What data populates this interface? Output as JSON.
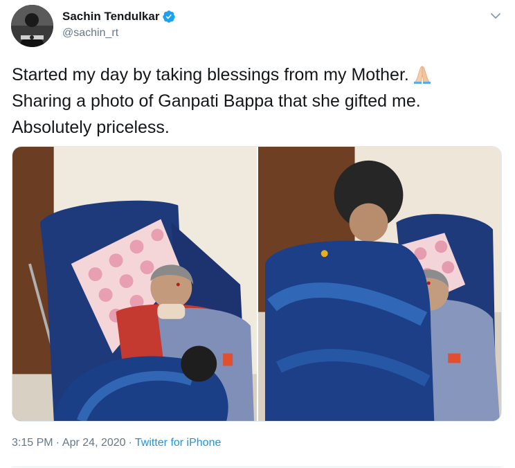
{
  "author": {
    "display_name": "Sachin Tendulkar",
    "handle": "@sachin_rt",
    "verified": true
  },
  "tweet": {
    "lines": [
      "Started my day by taking blessings from my Mother.",
      "Sharing a photo of Ganpati Bappa that she gifted me.",
      "Absolutely priceless."
    ],
    "emoji": "folded-hands"
  },
  "media": {
    "count": 2
  },
  "meta": {
    "time": "3:15 PM",
    "separator": "·",
    "date": "Apr 24, 2020",
    "source": "Twitter for iPhone"
  },
  "colors": {
    "text": "#14171a",
    "secondary": "#657786",
    "link": "#1b95e0",
    "verified": "#1da1f2"
  },
  "icons": {
    "verified": "verified-badge-icon",
    "menu": "chevron-down-icon",
    "emoji": "folded-hands-icon"
  }
}
